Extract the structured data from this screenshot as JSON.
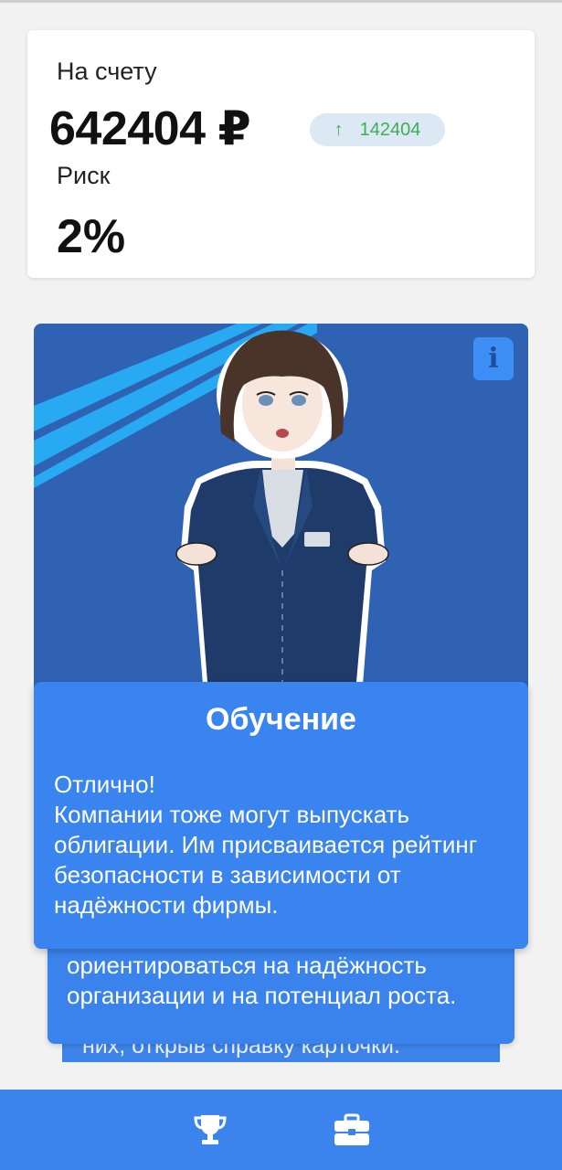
{
  "balance": {
    "label": "На счету",
    "amount": "642404 ₽",
    "delta": "142404",
    "delta_direction": "up",
    "delta_color": "#3fae52"
  },
  "risk": {
    "label": "Риск",
    "value": "2%"
  },
  "character_card": {
    "background": "#2f62b3",
    "stripe_color": "#27aaf2",
    "info_icon": "document-info-icon"
  },
  "tutorial": {
    "title": "Обучение",
    "text": "Отлично!\nКомпании тоже могут выпускать облигации. Им присваивается рейтинг безопасности в зависимости от надёжности фирмы."
  },
  "stacked_card": {
    "text": "ориентироваться на надёжность\nорганизации и на потенциал роста.",
    "back_text": "них, открыв справку карточки."
  },
  "bottom_nav": {
    "items": [
      {
        "icon": "trophy-icon"
      },
      {
        "icon": "briefcase-icon"
      }
    ]
  }
}
